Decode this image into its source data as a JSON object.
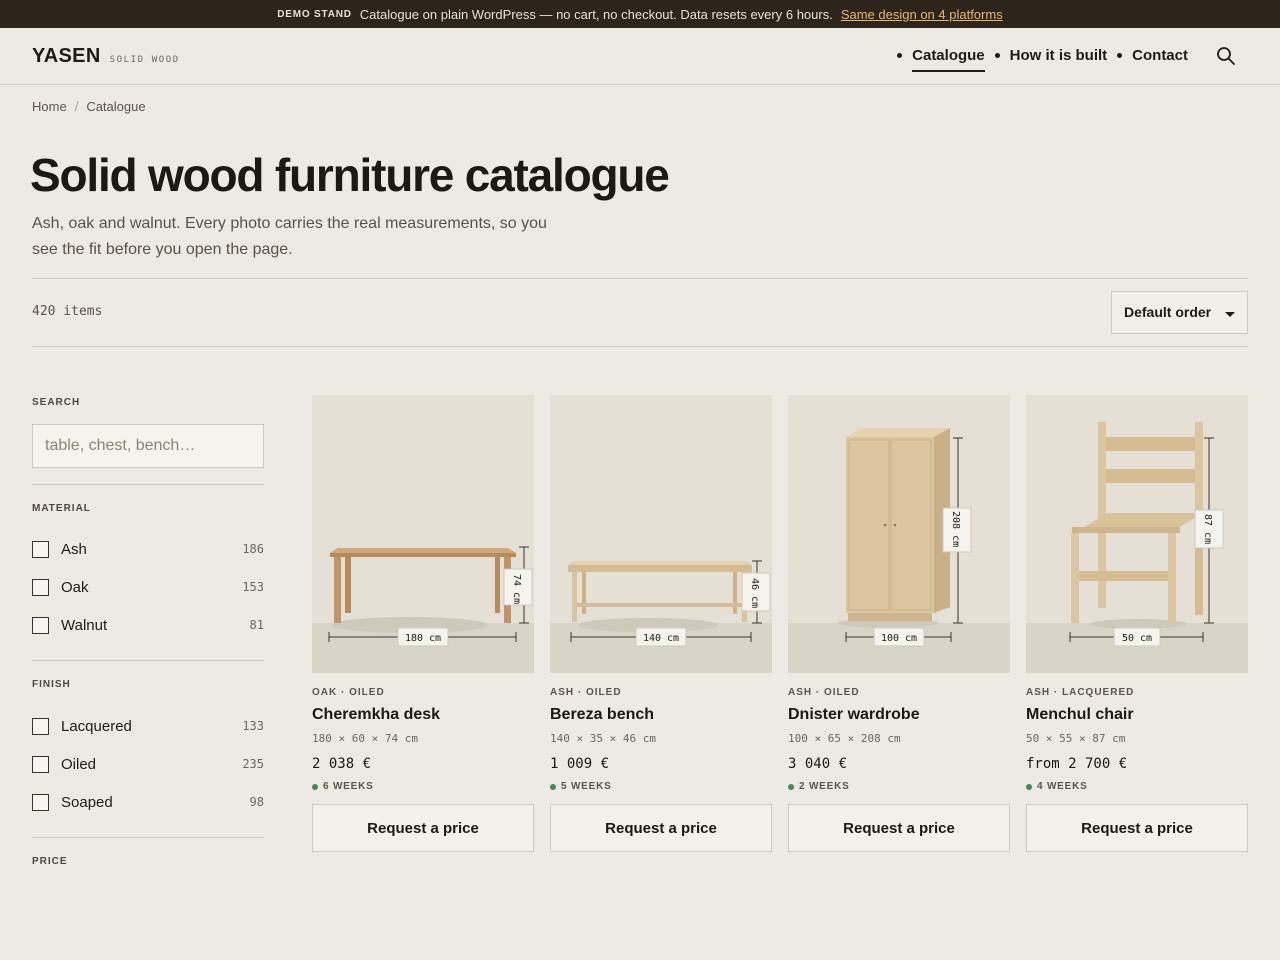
{
  "demo_bar": {
    "badge": "DEMO STAND",
    "message": "Catalogue on plain WordPress — no cart, no checkout.  Data resets every 6 hours.",
    "link": "Same design on 4 platforms"
  },
  "header": {
    "logo": "YASEN",
    "logo_sub": "SOLID WOOD",
    "nav": [
      "Catalogue",
      "How it is built",
      "Contact"
    ],
    "active_nav": "Catalogue",
    "search_icon": "search-icon"
  },
  "breadcrumb": [
    "Home",
    "Catalogue"
  ],
  "page": {
    "title": "Solid wood furniture catalogue",
    "subtitle": "Ash, oak and walnut. Every photo carries the real measurements, so you see the fit before you open the page.",
    "item_count": "420 items",
    "sort_value": "Default order"
  },
  "sidebar": {
    "search_label": "SEARCH",
    "search_placeholder": "table, chest, bench…",
    "material_label": "MATERIAL",
    "materials": [
      {
        "name": "Ash",
        "count": "186"
      },
      {
        "name": "Oak",
        "count": "153"
      },
      {
        "name": "Walnut",
        "count": "81"
      }
    ],
    "finish_label": "FINISH",
    "finishes": [
      {
        "name": "Lacquered",
        "count": "133"
      },
      {
        "name": "Oiled",
        "count": "235"
      },
      {
        "name": "Soaped",
        "count": "98"
      }
    ],
    "price_label": "PRICE"
  },
  "products": [
    {
      "meta": "OAK · OILED",
      "name": "Cheremkha desk",
      "dims": "180 × 60 × 74 cm",
      "price": "2 038 €",
      "lead": "6 WEEKS",
      "cta": "Request a price",
      "width_tag": "180 cm",
      "height_tag": "74 cm"
    },
    {
      "meta": "ASH · OILED",
      "name": "Bereza bench",
      "dims": "140 × 35 × 46 cm",
      "price": "1 009 €",
      "lead": "5 WEEKS",
      "cta": "Request a price",
      "width_tag": "140 cm",
      "height_tag": "46 cm"
    },
    {
      "meta": "ASH · OILED",
      "name": "Dnister wardrobe",
      "dims": "100 × 65 × 208 cm",
      "price": "3 040 €",
      "lead": "2 WEEKS",
      "cta": "Request a price",
      "width_tag": "100 cm",
      "height_tag": "208 cm"
    },
    {
      "meta": "ASH · LACQUERED",
      "name": "Menchul chair",
      "dims": "50 × 55 × 87 cm",
      "price": "from 2 700 €",
      "lead": "4 WEEKS",
      "cta": "Request a price",
      "width_tag": "50 cm",
      "height_tag": "87 cm"
    }
  ],
  "colors": {
    "background": "#edeae3",
    "demo_bar": "#2d241c",
    "accent_link": "#e5b96c",
    "lead_dot": "#3f8a58",
    "oak": "#c09466",
    "ash": "#dcc6a0"
  }
}
